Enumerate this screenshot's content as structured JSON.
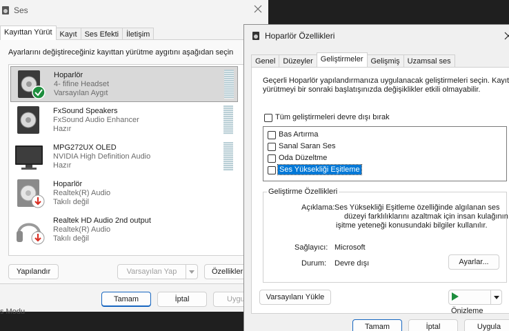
{
  "colors": {
    "accent": "#1565c0",
    "check_green": "#1e8e3e",
    "error_red": "#d93025",
    "selection": "#0078d7"
  },
  "sound": {
    "title": "Ses",
    "tabs": [
      {
        "label": "Kayıttan Yürüt",
        "active": true
      },
      {
        "label": "Kayıt",
        "active": false
      },
      {
        "label": "Ses Efekti",
        "active": false
      },
      {
        "label": "İletişim",
        "active": false
      }
    ],
    "instruction": "Ayarlarını değiştireceğiniz kayıttan yürütme aygıtını aşağıdan seçin",
    "devices": [
      {
        "name": "Hoparlör",
        "line1": "4- fifine Headset",
        "line2": "Varsayılan Aygıt",
        "icon": "speaker-icon",
        "badge": "check-icon",
        "selected": true
      },
      {
        "name": "FxSound Speakers",
        "line1": "FxSound Audio Enhancer",
        "line2": "Hazır",
        "icon": "speaker-icon",
        "badge": "",
        "selected": false
      },
      {
        "name": "MPG272UX OLED",
        "line1": "NVIDIA High Definition Audio",
        "line2": "Hazır",
        "icon": "monitor-icon",
        "badge": "",
        "selected": false
      },
      {
        "name": "Hoparlör",
        "line1": "Realtek(R) Audio",
        "line2": "Takılı değil",
        "icon": "speaker-icon",
        "badge": "unplugged-icon",
        "selected": false
      },
      {
        "name": "Realtek HD Audio 2nd output",
        "line1": "Realtek(R) Audio",
        "line2": "Takılı değil",
        "icon": "headphones-icon",
        "badge": "unplugged-icon",
        "selected": false
      }
    ],
    "configure": "Yapılandır",
    "set_default": "Varsayılan Yap",
    "properties": "Özellikler",
    "ok": "Tamam",
    "cancel": "İptal",
    "apply": "Uygula",
    "taskbar_hint": "s Modu"
  },
  "props": {
    "title": "Hoparlör Özellikleri",
    "tabs": [
      {
        "label": "Genel",
        "active": false
      },
      {
        "label": "Düzeyler",
        "active": false
      },
      {
        "label": "Geliştirmeler",
        "active": true
      },
      {
        "label": "Gelişmiş",
        "active": false
      },
      {
        "label": "Uzamsal ses",
        "active": false
      }
    ],
    "desc_line1": "Geçerli Hoparlör yapılandırmanıza uygulanacak geliştirmeleri seçin. Kayıttan",
    "desc_line2": "yürütmeyi bir sonraki başlatışınızda değişiklikler etkili olmayabilir.",
    "disable_all": "Tüm geliştirmeleri devre dışı bırak",
    "enhancements": [
      "Bas Artırma",
      "Sanal Saran Ses",
      "Oda Düzeltme",
      "Ses Yüksekliği Eşitleme"
    ],
    "group_title": "Geliştirme Özellikleri",
    "desc_label": "Açıklama:",
    "desc_value_lines": [
      "Ses Yüksekliği Eşitleme özelliğinde algılanan ses",
      "düzeyi farklılıklarını azaltmak için insan kulağının",
      "işitme yeteneği konusundaki bilgiler kullanılır."
    ],
    "provider_label": "Sağlayıcı:",
    "provider_value": "Microsoft",
    "status_label": "Durum:",
    "status_value": "Devre dışı",
    "settings": "Ayarlar...",
    "restore": "Varsayılanı Yükle",
    "preview": "Önizleme",
    "ok": "Tamam",
    "cancel": "İptal",
    "apply": "Uygula"
  }
}
